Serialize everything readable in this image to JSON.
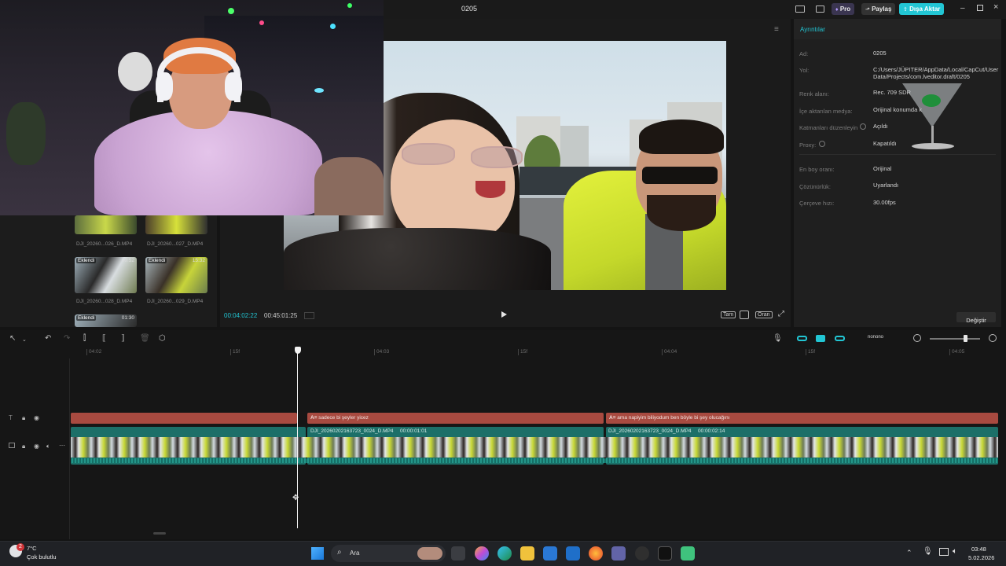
{
  "window": {
    "title": "0205",
    "pro_label": "Pro",
    "share_label": "Paylaş",
    "export_label": "Dışa Aktar",
    "accent": "#22c6d4"
  },
  "media": {
    "clips": [
      {
        "name": "DJI_20260...026_D.MP4",
        "badge": "",
        "duration": ""
      },
      {
        "name": "DJI_20260...027_D.MP4",
        "badge": "",
        "duration": ""
      },
      {
        "name": "DJI_20260...028_D.MP4",
        "badge": "Eklendi",
        "duration": "00:52"
      },
      {
        "name": "DJI_20260...029_D.MP4",
        "badge": "Eklendi",
        "duration": "15:32"
      },
      {
        "name": "",
        "badge": "Eklendi",
        "duration": "01:30"
      }
    ]
  },
  "player": {
    "current_time": "00:04:02:22",
    "total_time": "00:45:01:25",
    "full_label": "Tam",
    "ratio_label": "Oran"
  },
  "details": {
    "tab": "Ayrıntılar",
    "rows": [
      {
        "label": "Ad:",
        "value": "0205"
      },
      {
        "label": "Yol:",
        "value": "C:/Users/JÜPITER/AppData/Local/CapCut/User Data/Projects/com.lveditor.draft/0205"
      },
      {
        "label": "Renk alanı:",
        "value": "Rec. 709 SDR"
      },
      {
        "label": "İçe aktarılan medya:",
        "value": "Orijinal konumda k"
      },
      {
        "label": "Katmanları düzenleyin",
        "value": "Açıldı"
      },
      {
        "label": "Proxy:",
        "value": "Kapatıldı"
      },
      {
        "label": "En boy oranı:",
        "value": "Orijinal"
      },
      {
        "label": "Çözünürlük:",
        "value": "Uyarlandı"
      },
      {
        "label": "Çerçeve hızı:",
        "value": "30.00fps"
      }
    ],
    "change_button": "Değiştir"
  },
  "timeline": {
    "ruler": [
      "04:02",
      "15f",
      "04:03",
      "15f",
      "04:04",
      "15f",
      "04:05"
    ],
    "text_clips": [
      {
        "text": ""
      },
      {
        "text": "sadece bi şeyler yicez"
      },
      {
        "text": "ama napiyim biliyodum ben böyle bi şey olucağını"
      }
    ],
    "video_clips": [
      {
        "name": "DJI_20260202163723_0024_D.MP4",
        "duration": "00:00:01:01"
      },
      {
        "name": "DJI_20260202163723_0024_D.MP4",
        "duration": "00:00:02:14"
      }
    ],
    "overlay_text": "nonono"
  },
  "taskbar": {
    "weather_temp": "7°C",
    "weather_desc": "Çok bulutlu",
    "weather_badge": "2",
    "search_placeholder": "Ara",
    "time": "03:48",
    "date": "5.02.2026"
  }
}
